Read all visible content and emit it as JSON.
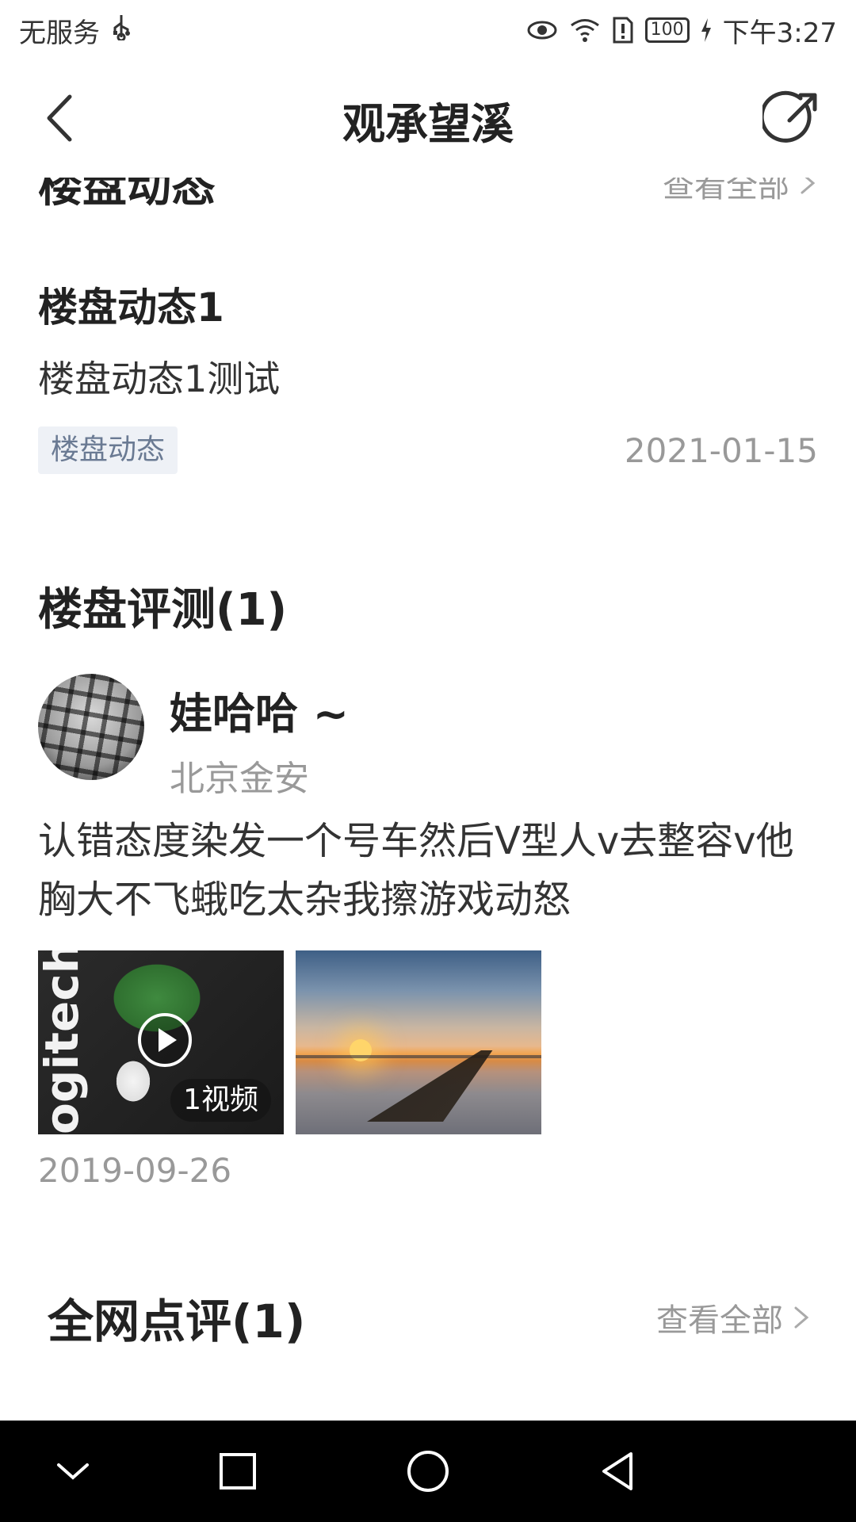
{
  "status_bar": {
    "carrier": "无服务",
    "battery": "100",
    "time": "下午3:27"
  },
  "header": {
    "title": "观承望溪"
  },
  "news_section": {
    "title": "楼盘动态",
    "see_all": "查看全部",
    "item": {
      "title": "楼盘动态1",
      "desc": "楼盘动态1测试",
      "tag": "楼盘动态",
      "date": "2021-01-15"
    }
  },
  "review_section": {
    "title": "楼盘评测(1)",
    "user": {
      "name": "娃哈哈 ~",
      "location": "北京金安"
    },
    "text": "认错态度染发一个号车然后V型人v去整容v他胸大不飞蛾吃太杂我擦游戏动怒",
    "media": {
      "video_logo_text": "ogitech",
      "video_badge": "1视频"
    },
    "date": "2019-09-26"
  },
  "comments_section": {
    "title": "全网点评(1)",
    "see_all": "查看全部"
  },
  "icons": {
    "back": "back-chevron-icon",
    "share": "share-icon",
    "play": "play-icon",
    "sys_back": "triangle-back-icon",
    "sys_home": "circle-home-icon",
    "sys_recent": "square-recent-icon",
    "sys_hide": "chevron-down-icon"
  },
  "colors": {
    "tag_bg": "#eef1f6",
    "tag_text": "#6a7a93",
    "muted": "#999999"
  }
}
